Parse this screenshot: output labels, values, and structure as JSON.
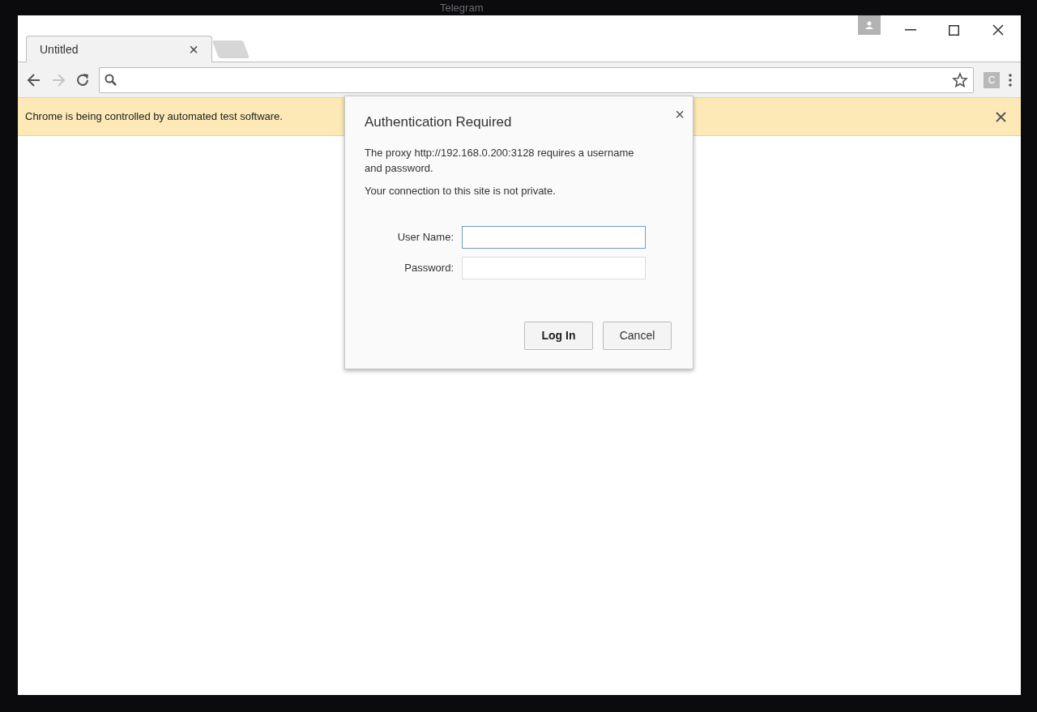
{
  "background": {
    "title": "Telegram"
  },
  "tabs": [
    {
      "title": "Untitled",
      "close": "×",
      "selected": true
    }
  ],
  "extension": {
    "label": "C"
  },
  "infobar": {
    "message": "Chrome is being controlled by automated test software."
  },
  "dialog": {
    "title": "Authentication Required",
    "close": "×",
    "message": "The proxy http://192.168.0.200:3128 requires a username and password.",
    "note": "Your connection to this site is not private.",
    "fields": [
      {
        "label": "User Name:",
        "focused": true
      },
      {
        "label": "Password:",
        "focused": false
      }
    ],
    "buttons": [
      {
        "label": "Log In",
        "default": true
      },
      {
        "label": "Cancel",
        "default": false
      }
    ]
  }
}
